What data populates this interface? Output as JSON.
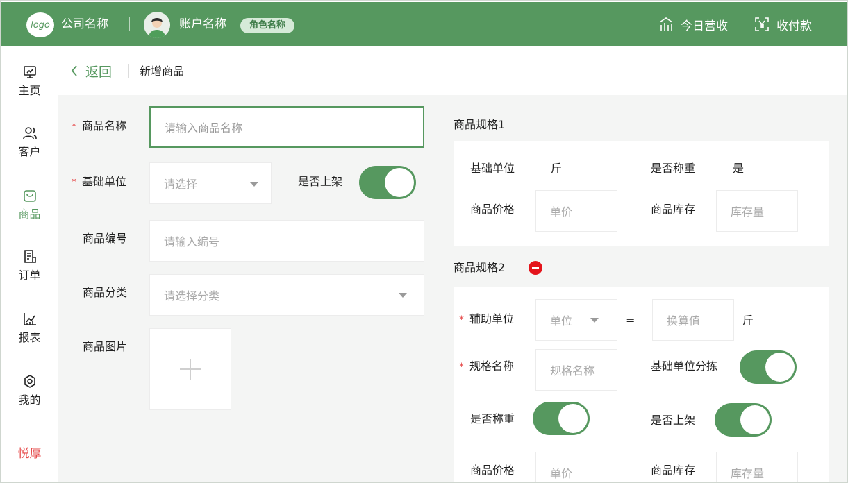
{
  "header": {
    "logo_text": "logo",
    "company": "公司名称",
    "account": "账户名称",
    "role": "角色名称",
    "today_revenue": "今日营收",
    "collect_payment": "收付款"
  },
  "sidebar": {
    "items": [
      {
        "label": "主页",
        "icon": "monitor-icon"
      },
      {
        "label": "客户",
        "icon": "users-icon"
      },
      {
        "label": "商品",
        "icon": "bag-icon",
        "active": true
      },
      {
        "label": "订单",
        "icon": "order-icon"
      },
      {
        "label": "报表",
        "icon": "chart-icon"
      },
      {
        "label": "我的",
        "icon": "gear-icon"
      }
    ],
    "brand": "悦厚"
  },
  "topbar": {
    "back": "返回",
    "title": "新增商品"
  },
  "form": {
    "name_label": "商品名称",
    "name_placeholder": "请输入商品名称",
    "unit_label": "基础单位",
    "unit_placeholder": "请选择",
    "on_shelf_label": "是否上架",
    "code_label": "商品编号",
    "code_placeholder": "请输入编号",
    "category_label": "商品分类",
    "category_placeholder": "请选择分类",
    "image_label": "商品图片"
  },
  "spec1": {
    "title": "商品规格1",
    "base_unit_label": "基础单位",
    "base_unit_value": "斤",
    "weigh_label": "是否称重",
    "weigh_value": "是",
    "price_label": "商品价格",
    "price_placeholder": "单价",
    "stock_label": "商品库存",
    "stock_placeholder": "库存量"
  },
  "spec2": {
    "title": "商品规格2",
    "aux_unit_label": "辅助单位",
    "aux_unit_placeholder": "单位",
    "equals": "=",
    "conversion_placeholder": "换算值",
    "conversion_unit": "斤",
    "spec_name_label": "规格名称",
    "spec_name_placeholder": "规格名称",
    "base_sort_label": "基础单位分拣",
    "weigh_label": "是否称重",
    "on_shelf_label": "是否上架",
    "price_label": "商品价格",
    "price_placeholder": "单价",
    "stock_label": "商品库存",
    "stock_placeholder": "库存量"
  },
  "colors": {
    "primary": "#56985f",
    "danger": "#e64b4b",
    "remove": "#e4141b"
  }
}
